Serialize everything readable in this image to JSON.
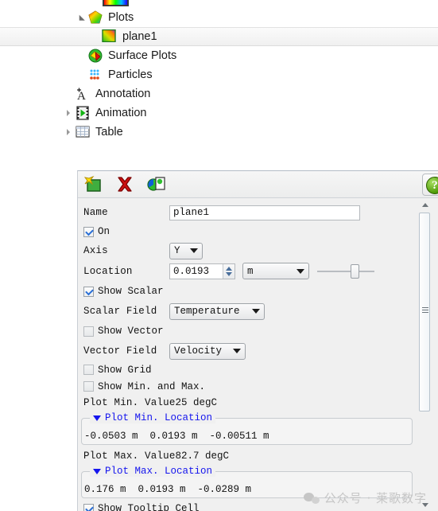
{
  "tree": {
    "items": [
      {
        "label": "Plots",
        "icon": "plots-icon",
        "indent": 26,
        "expander": "open",
        "selected": false
      },
      {
        "label": "plane1",
        "icon": "plane-gradient-icon",
        "indent": 58,
        "expander": "none",
        "selected": true
      },
      {
        "label": "Surface Plots",
        "icon": "surface-plots-icon",
        "indent": 40,
        "expander": "none",
        "selected": false
      },
      {
        "label": "Particles",
        "icon": "particles-icon",
        "indent": 40,
        "expander": "none",
        "selected": false
      },
      {
        "label": "Annotation",
        "icon": "annotation-icon",
        "indent": 18,
        "expander": "none",
        "selected": false
      },
      {
        "label": "Animation",
        "icon": "animation-icon",
        "indent": 18,
        "expander": "closed",
        "selected": false
      },
      {
        "label": "Table",
        "icon": "table-icon",
        "indent": 18,
        "expander": "closed",
        "selected": false
      }
    ]
  },
  "toolbar": {
    "new_label": "new-plot",
    "delete_label": "delete-plot",
    "copy_label": "copy-plot",
    "help_label": "?"
  },
  "form": {
    "name": {
      "label": "Name",
      "value": "plane1"
    },
    "on": {
      "label": "On",
      "checked": true
    },
    "axis": {
      "label": "Axis",
      "value": "Y"
    },
    "location": {
      "label": "Location",
      "value": "0.0193",
      "unit": "m"
    },
    "show_scalar": {
      "label": "Show Scalar",
      "checked": true
    },
    "scalar_field": {
      "label": "Scalar Field",
      "value": "Temperature"
    },
    "show_vector": {
      "label": "Show  Vector",
      "checked": false
    },
    "vector_field": {
      "label": "Vector Field",
      "value": "Velocity"
    },
    "show_grid": {
      "label": "Show Grid",
      "checked": false
    },
    "show_min_and_max": {
      "label": "Show Min. and Max.",
      "checked": false
    },
    "plot_min_value": {
      "label": "Plot Min. Value",
      "value": "25 degC"
    },
    "plot_min_location": {
      "title": "Plot Min. Location",
      "value": "-0.0503 m  0.0193 m  -0.00511 m"
    },
    "plot_max_value": {
      "label": "Plot Max. Value",
      "value": "82.7 degC"
    },
    "plot_max_location": {
      "title": "Plot Max. Location",
      "value": "0.176 m  0.0193 m  -0.0289 m"
    },
    "show_tooltip_cell": {
      "label": "Show Tooltip Cell",
      "checked": true
    }
  },
  "watermark": {
    "text": "公众号 · 莱歌数字"
  },
  "colors": {
    "link_blue": "#1515ee",
    "check_blue": "#2a6fd6",
    "panel_bg": "#f0f0f0",
    "field_bg": "#ffffff"
  }
}
